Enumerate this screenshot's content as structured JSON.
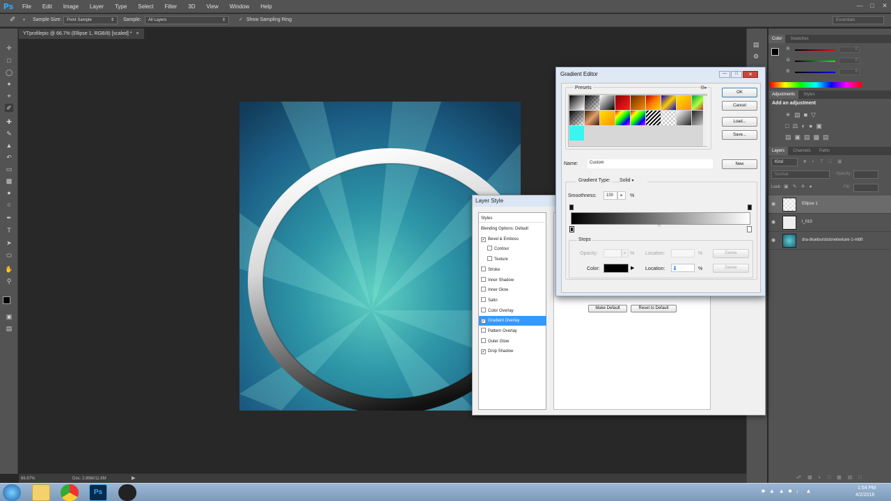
{
  "app": {
    "logo": "Ps"
  },
  "menu": [
    "File",
    "Edit",
    "Image",
    "Layer",
    "Type",
    "Select",
    "Filter",
    "3D",
    "View",
    "Window",
    "Help"
  ],
  "options_bar": {
    "sample_size_label": "Sample Size:",
    "sample_size_value": "Point Sample",
    "sample_label": "Sample:",
    "sample_value": "All Layers",
    "show_ring_label": "Show Sampling Ring",
    "workspace": "Essentials"
  },
  "document": {
    "tab_title": "YTprofilepic @ 66.7% (Ellipse 1, RGB/8) [scaled] *",
    "zoom": "66.67%",
    "doc_size": "Doc: 2.86M/11.6M"
  },
  "panels": {
    "color_tabs": [
      "Color",
      "Swatches"
    ],
    "color_channels": [
      "R",
      "G",
      "B"
    ],
    "color_values": [
      "0",
      "0",
      "0"
    ],
    "adjust_tabs": [
      "Adjustments",
      "Styles"
    ],
    "adjust_heading": "Add an adjustment",
    "layers_tabs": [
      "Layers",
      "Channels",
      "Paths"
    ],
    "layers_kind": "Kind",
    "blend_mode": "Normal",
    "opacity_label": "Opacity:",
    "lock_label": "Lock:",
    "fill_label": "Fill:",
    "layers": [
      {
        "name": "Ellipse 1",
        "selected": true
      },
      {
        "name": "l_010",
        "selected": false
      },
      {
        "name": "dra-blueburststonetexture-1-mbft",
        "selected": false
      }
    ]
  },
  "layer_style": {
    "title": "Layer Style",
    "styles_header": "Styles",
    "items": [
      {
        "label": "Blending Options: Default",
        "checkbox": false,
        "checked": false,
        "indent": false,
        "selected": false
      },
      {
        "label": "Bevel & Emboss",
        "checkbox": true,
        "checked": true,
        "indent": false,
        "selected": false
      },
      {
        "label": "Contour",
        "checkbox": true,
        "checked": false,
        "indent": true,
        "selected": false
      },
      {
        "label": "Texture",
        "checkbox": true,
        "checked": false,
        "indent": true,
        "selected": false
      },
      {
        "label": "Stroke",
        "checkbox": true,
        "checked": false,
        "indent": false,
        "selected": false
      },
      {
        "label": "Inner Shadow",
        "checkbox": true,
        "checked": false,
        "indent": false,
        "selected": false
      },
      {
        "label": "Inner Glow",
        "checkbox": true,
        "checked": false,
        "indent": false,
        "selected": false
      },
      {
        "label": "Satin",
        "checkbox": true,
        "checked": false,
        "indent": false,
        "selected": false
      },
      {
        "label": "Color Overlay",
        "checkbox": true,
        "checked": false,
        "indent": false,
        "selected": false
      },
      {
        "label": "Gradient Overlay",
        "checkbox": true,
        "checked": true,
        "indent": false,
        "selected": true
      },
      {
        "label": "Pattern Overlay",
        "checkbox": true,
        "checked": false,
        "indent": false,
        "selected": false
      },
      {
        "label": "Outer Glow",
        "checkbox": true,
        "checked": false,
        "indent": false,
        "selected": false
      },
      {
        "label": "Drop Shadow",
        "checkbox": true,
        "checked": true,
        "indent": false,
        "selected": false
      }
    ],
    "make_default": "Make Default",
    "reset_default": "Reset to Default"
  },
  "gradient_editor": {
    "title": "Gradient Editor",
    "presets_label": "Presets",
    "ok": "OK",
    "cancel": "Cancel",
    "load": "Load...",
    "save": "Save...",
    "name_label": "Name:",
    "name_value": "Custom",
    "new_button": "New",
    "gradient_type_label": "Gradient Type:",
    "gradient_type_value": "Solid",
    "smoothness_label": "Smoothness:",
    "smoothness_value": "100",
    "percent": "%",
    "stops_label": "Stops",
    "opacity_label": "Opacity:",
    "location_label": "Location:",
    "delete_label": "Delete",
    "color_label": "Color:",
    "color_location_value": "0"
  },
  "taskbar": {
    "time": "1:54 PM",
    "date": "4/2/2016"
  },
  "colors": {
    "accent": "#3399ff",
    "panel": "#535353",
    "bg": "#282828"
  }
}
